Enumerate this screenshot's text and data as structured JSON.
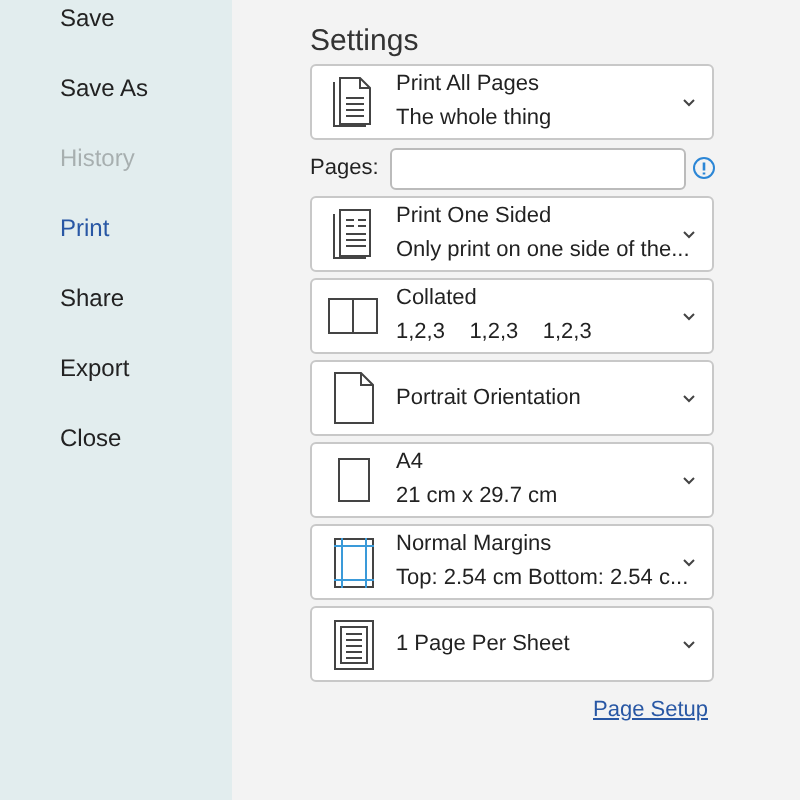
{
  "sidebar": {
    "items": [
      {
        "label": "Save",
        "selected": false,
        "disabled": false
      },
      {
        "label": "Save As",
        "selected": false,
        "disabled": false
      },
      {
        "label": "History",
        "selected": false,
        "disabled": true
      },
      {
        "label": "Print",
        "selected": true,
        "disabled": false
      },
      {
        "label": "Share",
        "selected": false,
        "disabled": false
      },
      {
        "label": "Export",
        "selected": false,
        "disabled": false
      },
      {
        "label": "Close",
        "selected": false,
        "disabled": false
      }
    ]
  },
  "settings": {
    "title": "Settings",
    "dropdowns_top": [
      {
        "kind": "pages",
        "title": "Print All Pages",
        "subtitle": "The whole thing"
      }
    ],
    "pages_field": {
      "label": "Pages:"
    },
    "dropdowns": [
      {
        "kind": "one-sided",
        "title": "Print One Sided",
        "subtitle": "Only print on one side of the..."
      },
      {
        "kind": "collated",
        "title": "Collated",
        "subtitle": "1,2,3    1,2,3    1,2,3"
      },
      {
        "kind": "portrait",
        "title": "Portrait Orientation"
      },
      {
        "kind": "paper",
        "title": "A4",
        "subtitle": "21 cm x 29.7 cm"
      },
      {
        "kind": "margins",
        "title": "Normal Margins",
        "subtitle": "Top: 2.54 cm Bottom: 2.54 c..."
      },
      {
        "kind": "per-sheet",
        "title": "1 Page Per Sheet"
      }
    ],
    "link": "Page Setup"
  }
}
